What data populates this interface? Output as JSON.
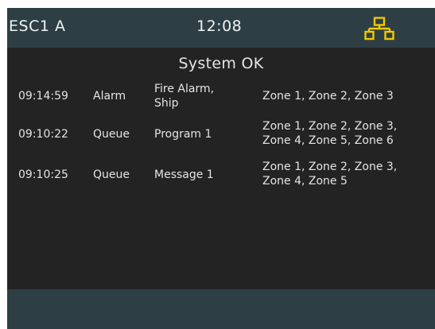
{
  "header": {
    "station": "ESC1 A",
    "clock": "12:08",
    "network_icon": "network-icon",
    "network_color": "#f2c800"
  },
  "main": {
    "status": "System OK",
    "events": [
      {
        "time": "09:14:59",
        "type": "Alarm",
        "text_line1": "Fire Alarm,",
        "text_line2": "Ship",
        "zones_line1": "Zone 1, Zone 2, Zone 3",
        "zones_line2": ""
      },
      {
        "time": "09:10:22",
        "type": "Queue",
        "text_line1": "Program 1",
        "text_line2": "",
        "zones_line1": "Zone 1, Zone 2, Zone 3,",
        "zones_line2": "Zone 4, Zone 5, Zone 6"
      },
      {
        "time": "09:10:25",
        "type": "Queue",
        "text_line1": "Message 1",
        "text_line2": "",
        "zones_line1": "Zone 1, Zone 2, Zone 3,",
        "zones_line2": "Zone 4, Zone 5"
      }
    ]
  },
  "colors": {
    "header_bg": "#2d3f44",
    "main_bg": "#232323",
    "text": "#e4e4e4"
  }
}
